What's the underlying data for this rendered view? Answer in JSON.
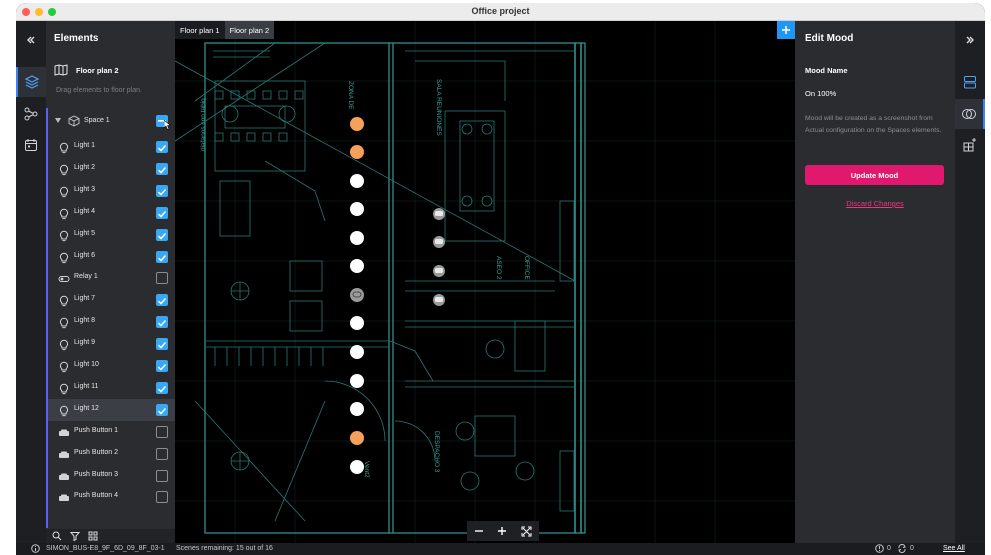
{
  "window": {
    "title": "Office project"
  },
  "left_panel": {
    "title": "Elements",
    "floor_plan": "Floor plan 2",
    "hint": "Drag elements to floor plan.",
    "space": {
      "label": "Space 1",
      "checked": true
    },
    "items": [
      {
        "label": "Light 1",
        "icon": "bulb-icon",
        "checked": true
      },
      {
        "label": "Light 2",
        "icon": "bulb-icon",
        "checked": true
      },
      {
        "label": "Light 3",
        "icon": "bulb-icon",
        "checked": true
      },
      {
        "label": "Light 4",
        "icon": "bulb-icon",
        "checked": true
      },
      {
        "label": "Light 5",
        "icon": "bulb-icon",
        "checked": true
      },
      {
        "label": "Light 6",
        "icon": "bulb-icon",
        "checked": true
      },
      {
        "label": "Relay 1",
        "icon": "relay-icon",
        "checked": false
      },
      {
        "label": "Light 7",
        "icon": "bulb-icon",
        "checked": true
      },
      {
        "label": "Light 8",
        "icon": "bulb-icon",
        "checked": true
      },
      {
        "label": "Light 9",
        "icon": "bulb-icon",
        "checked": true
      },
      {
        "label": "Light 10",
        "icon": "bulb-icon",
        "checked": true
      },
      {
        "label": "Light 11",
        "icon": "bulb-icon",
        "checked": true
      },
      {
        "label": "Light 12",
        "icon": "bulb-icon",
        "checked": true
      },
      {
        "label": "Push Button 1",
        "icon": "push-button-icon",
        "checked": false
      },
      {
        "label": "Push Button 2",
        "icon": "push-button-icon",
        "checked": false
      },
      {
        "label": "Push Button 3",
        "icon": "push-button-icon",
        "checked": false
      },
      {
        "label": "Push Button 4",
        "icon": "push-button-icon",
        "checked": false
      }
    ]
  },
  "canvas": {
    "tabs": [
      {
        "label": "Floor plan 1",
        "active": false
      },
      {
        "label": "Floor plan 2",
        "active": true
      }
    ],
    "plan_labels": {
      "zona": "ZONA DE",
      "sala": "SALA REUNIONES",
      "diafanos": "diafanos con tabiq",
      "despacho": "DESPACHO 3",
      "vent": "Vent2",
      "aseo": "ASEO 2",
      "office": "OFFICE"
    }
  },
  "right_panel": {
    "title": "Edit Mood",
    "mood_name_label": "Mood Name",
    "mood_value": "On 100%",
    "note": "Mood will be created as a screenshot from Actual configuration on the Spaces elements.",
    "update_button": "Update Mood",
    "discard_link": "Discard Changes"
  },
  "status_bar": {
    "device": "SIMON_BUS-E8_9F_6D_09_8F_03-1",
    "scenes": "Scenes remaining: 15 out of 16",
    "alerts_count": "0",
    "sync_count": "0",
    "see_all": "See All"
  },
  "colors": {
    "accent_blue": "#38a8f4",
    "brand_pink": "#e0196e",
    "light_on": "#f6a15a",
    "light_white": "#ffffff",
    "plan_lines": "#3fb6b0"
  }
}
